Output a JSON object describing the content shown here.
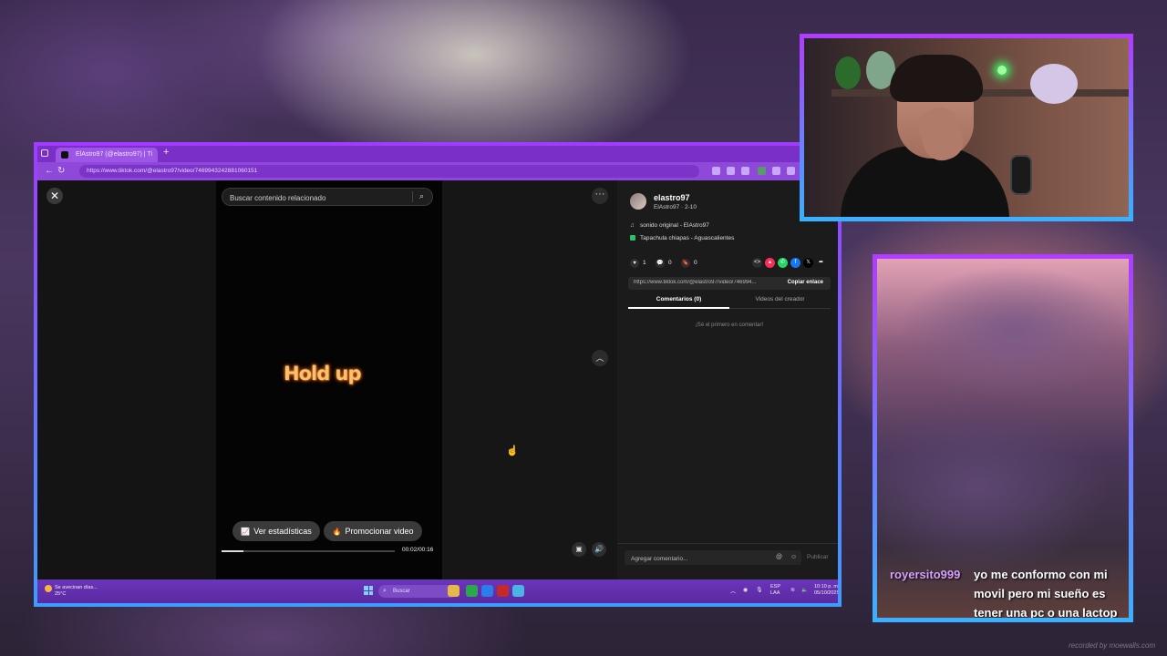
{
  "browser": {
    "tab_title": "ElAstro97 (@elastro97) | Ti",
    "new_tab_symbol": "+",
    "url": "https://www.tiktok.com/@elastro97/video/7469943242881060151"
  },
  "tiktok": {
    "search_placeholder": "Buscar contenido relacionado",
    "video_overlay_text": "Hold up",
    "btn_stats": "Ver estadísticas",
    "btn_promote": "Promocionar video",
    "progress_fraction": 0.125,
    "time": "00:02/00:16",
    "creator": {
      "username": "elastro97",
      "subtitle": "ElAstro97 · 2-10",
      "sound": "sonido original - ElAstro97",
      "location": "Tapachula chiapas - Aguascalientes"
    },
    "actions": {
      "likes": "1",
      "comments": "0",
      "saves": "0"
    },
    "link": "https://www.tiktok.com/@elastro97/video/746994...",
    "copy_link": "Copiar enlace",
    "tabs": [
      "Comentarios (0)",
      "Videos del creador"
    ],
    "empty_comments": "¡Sé el primero en comentar!",
    "comment_placeholder": "Agregar comentario...",
    "publish": "Publicar"
  },
  "taskbar": {
    "weather_line1": "Se avecinan días...",
    "weather_line2": "25°C",
    "search_label": "Buscar",
    "lang_line1": "ESP",
    "lang_line2": "LAA",
    "time": "10:10 p. m.",
    "date": "05/10/2025"
  },
  "stream_chat": {
    "user": "royersito999",
    "message": "yo me conformo con mi movil pero mi sueño es tener una pc o una lactop"
  },
  "watermark": "recorded by moewalls.com",
  "colors": {
    "frame_top": "#b13cff",
    "frame_bottom": "#3ab0ff",
    "taskbar": "#6b35b8"
  }
}
